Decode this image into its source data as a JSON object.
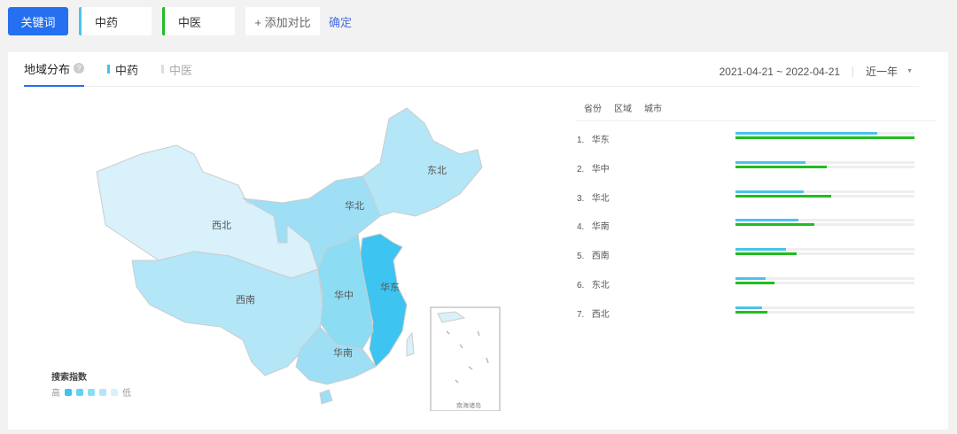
{
  "topbar": {
    "keyword_button": "关键词",
    "terms": [
      {
        "label": "中药",
        "color": "#4cc3ea"
      },
      {
        "label": "中医",
        "color": "#22bb22"
      }
    ],
    "add_compare": "+ 添加对比",
    "confirm": "确定"
  },
  "panel": {
    "tab": "地域分布",
    "help": "?",
    "series": [
      {
        "label": "中药",
        "color": "#3ec4ee",
        "active": true
      },
      {
        "label": "中医",
        "color": "#cccccc",
        "active": false
      }
    ],
    "date_range": "2021-04-21 ~ 2022-04-21",
    "period": "近一年"
  },
  "map": {
    "regions": [
      "西北",
      "华北",
      "东北",
      "华中",
      "华东",
      "西南",
      "华南"
    ],
    "inset_label": "南海诸岛",
    "legend": {
      "title": "搜索指数",
      "high": "高",
      "low": "低",
      "colors": [
        "#3ec4f0",
        "#66d0f2",
        "#8cdcf4",
        "#b3e6f7",
        "#d8f1fb"
      ]
    }
  },
  "ranking": {
    "tabs": [
      "省份",
      "区域",
      "城市"
    ],
    "colors": {
      "中药": "#4cc3ea",
      "中医": "#22bb22"
    },
    "rows": [
      {
        "rank": "1.",
        "name": "华东",
        "zhongyao": 0.79,
        "zhongyi": 1.0
      },
      {
        "rank": "2.",
        "name": "华中",
        "zhongyao": 0.39,
        "zhongyi": 0.51
      },
      {
        "rank": "3.",
        "name": "华北",
        "zhongyao": 0.38,
        "zhongyi": 0.535
      },
      {
        "rank": "4.",
        "name": "华南",
        "zhongyao": 0.35,
        "zhongyi": 0.44
      },
      {
        "rank": "5.",
        "name": "西南",
        "zhongyao": 0.28,
        "zhongyi": 0.34
      },
      {
        "rank": "6.",
        "name": "东北",
        "zhongyao": 0.17,
        "zhongyi": 0.22
      },
      {
        "rank": "7.",
        "name": "西北",
        "zhongyao": 0.15,
        "zhongyi": 0.18
      }
    ]
  }
}
